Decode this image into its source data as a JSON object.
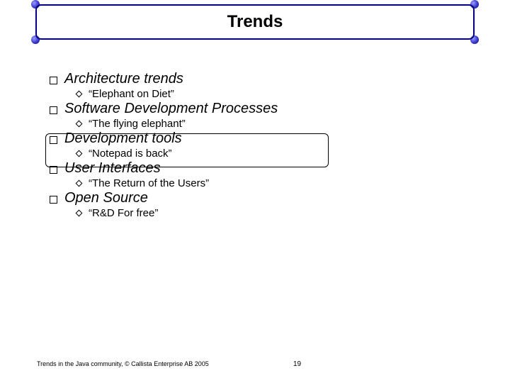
{
  "title": "Trends",
  "items": [
    {
      "heading": "Architecture trends",
      "sub": "“Elephant on Diet”"
    },
    {
      "heading": "Software Development Processes",
      "sub": "“The flying elephant”"
    },
    {
      "heading": "Development tools",
      "sub": "“Notepad is back”"
    },
    {
      "heading": "User Interfaces",
      "sub": "“The Return of the Users”"
    },
    {
      "heading": "Open Source",
      "sub": "“R&D For free”"
    }
  ],
  "footer": "Trends in the Java community, © Callista Enterprise AB 2005",
  "page_number": "19"
}
